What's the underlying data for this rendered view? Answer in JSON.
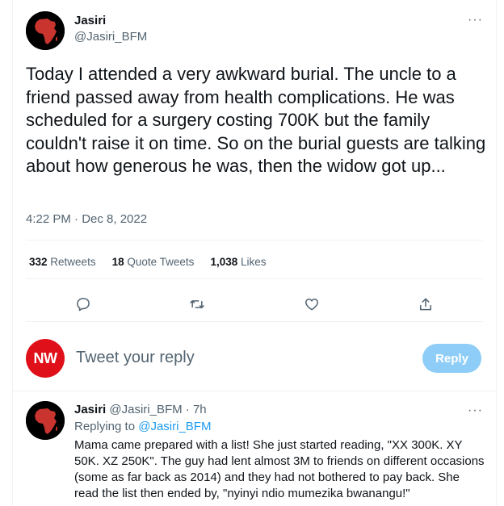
{
  "tweet": {
    "author_name": "Jasiri",
    "author_handle": "@Jasiri_BFM",
    "text": "Today I attended a very awkward burial. The uncle to a friend passed away from health complications. He was scheduled for a surgery costing 700K but the family couldn't raise it on time. So on the burial guests are talking about how generous he was, then the widow got up...",
    "timestamp": "4:22 PM · Dec 8, 2022",
    "more_icon": "···"
  },
  "stats": {
    "retweets_count": "332",
    "retweets_label": "Retweets",
    "quotes_count": "18",
    "quotes_label": "Quote Tweets",
    "likes_count": "1,038",
    "likes_label": "Likes"
  },
  "actions": [
    "reply-icon",
    "retweet-icon",
    "like-icon",
    "share-icon"
  ],
  "composer": {
    "avatar_text": "NW",
    "placeholder": "Tweet your reply",
    "reply_button": "Reply"
  },
  "reply": {
    "author_name": "Jasiri",
    "author_handle": "@Jasiri_BFM",
    "time": "· 7h",
    "replying_prefix": "Replying to",
    "replying_to": "@Jasiri_BFM",
    "text": "Mama came prepared with a list! She just started reading, \"XX 300K. XY 50K. XZ 250K\". The guy had lent almost 3M to friends on different occasions (some as far back as 2014) and they had not bothered to pay back. She read the list then ended by, \"nyinyi ndio mumezika bwanangu!\"",
    "more_icon": "···"
  },
  "colors": {
    "accent": "#1d9bf0",
    "reply_button_disabled": "#8ecdf7",
    "nw_red": "#e0101a",
    "secondary_text": "#536471"
  }
}
